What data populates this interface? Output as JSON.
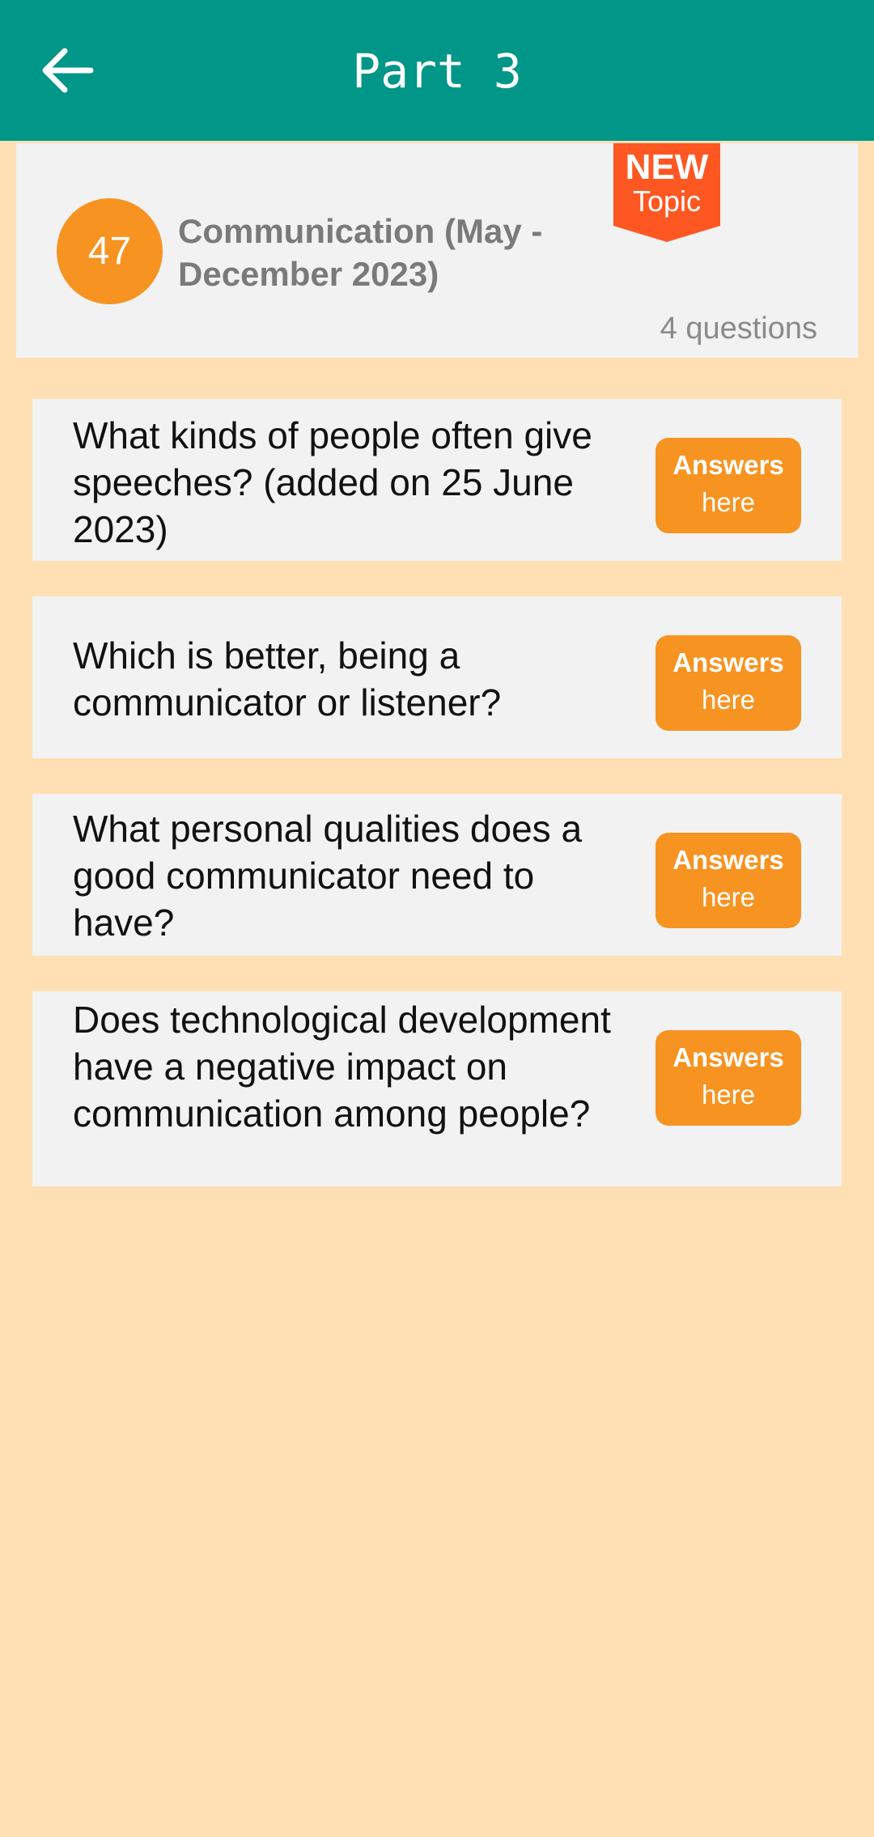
{
  "appbar": {
    "title": "Part 3",
    "back_icon": "arrow-left-icon",
    "color": "#009688"
  },
  "topic": {
    "number": "47",
    "title": "Communication (May - December 2023)",
    "question_count": "4 questions",
    "badge_line1": "NEW",
    "badge_line2": "Topic",
    "badge_color": "#FF5722",
    "number_color": "#F79321"
  },
  "questions": [
    {
      "text": "What kinds of people often give speeches? (added on 25 June 2023)",
      "button_line1": "Answers",
      "button_line2": "here"
    },
    {
      "text": "Which is better, being a communicator or listener?",
      "button_line1": "Answers",
      "button_line2": "here"
    },
    {
      "text": "What personal qualities does a good communicator need to have?",
      "button_line1": "Answers",
      "button_line2": "here"
    },
    {
      "text": "Does technological development have a negative impact on communication among people?",
      "button_line1": "Answers",
      "button_line2": "here"
    }
  ],
  "colors": {
    "background": "#FEE0B4",
    "card": "#F2F2F2",
    "accent": "#F79321"
  }
}
